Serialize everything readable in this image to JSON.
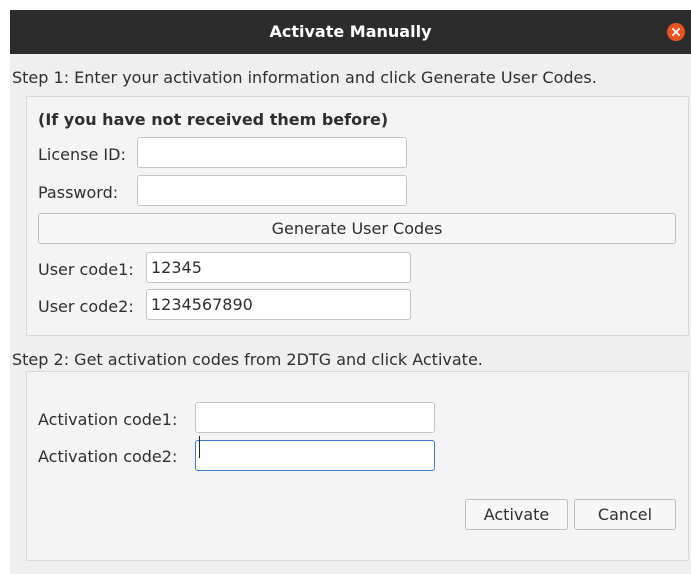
{
  "window": {
    "title": "Activate Manually",
    "close_icon": "close-icon",
    "accent_color": "#e95420"
  },
  "step1": {
    "label": "Step 1: Enter your activation information and click Generate User Codes.",
    "note": "(If you have not received them before)",
    "license_id_label": "License ID:",
    "license_id_value": "",
    "password_label": "Password:",
    "password_value": "",
    "generate_button": "Generate User Codes",
    "user_code1_label": "User code1:",
    "user_code1_value": "12345",
    "user_code2_label": "User code2:",
    "user_code2_value": "1234567890"
  },
  "step2": {
    "label": "Step 2: Get activation codes from 2DTG and click Activate.",
    "activation_code1_label": "Activation code1:",
    "activation_code1_value": "",
    "activation_code2_label": "Activation code2:",
    "activation_code2_value": ""
  },
  "buttons": {
    "activate": "Activate",
    "cancel": "Cancel"
  }
}
